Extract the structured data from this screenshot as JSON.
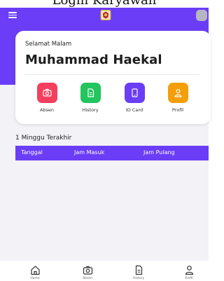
{
  "page_title": "Login Karyawan",
  "app_bar": {
    "menu_icon": "hamburger-menu-icon",
    "logo_icon": "emblem-logo-icon",
    "avatar": "user-avatar"
  },
  "colors": {
    "primary": "#6b3df6",
    "background": "#f3f2f7",
    "card": "#ffffff",
    "absen": "#f43f5e",
    "history": "#22c55e",
    "id_card": "#6b3df6",
    "profil": "#f59e0b"
  },
  "card": {
    "greeting": "Selamat Malam",
    "name": "Muhammad Haekal"
  },
  "menu": [
    {
      "label": "Absen",
      "icon": "camera-icon",
      "color": "#f43f5e"
    },
    {
      "label": "History",
      "icon": "document-icon",
      "color": "#22c55e"
    },
    {
      "label": "ID Card",
      "icon": "phone-card-icon",
      "color": "#6b3df6"
    },
    {
      "label": "Profil",
      "icon": "user-icon",
      "color": "#f59e0b"
    }
  ],
  "section": {
    "title": "1 Minggu Terakhir"
  },
  "table": {
    "columns": [
      "Tanggal",
      "Jam Masuk",
      "Jam Pulang"
    ]
  },
  "bottom_nav": [
    {
      "label": "Home",
      "icon": "home-icon"
    },
    {
      "label": "Absen",
      "icon": "camera-icon"
    },
    {
      "label": "History",
      "icon": "document-icon"
    },
    {
      "label": "Profil",
      "icon": "user-icon"
    }
  ]
}
